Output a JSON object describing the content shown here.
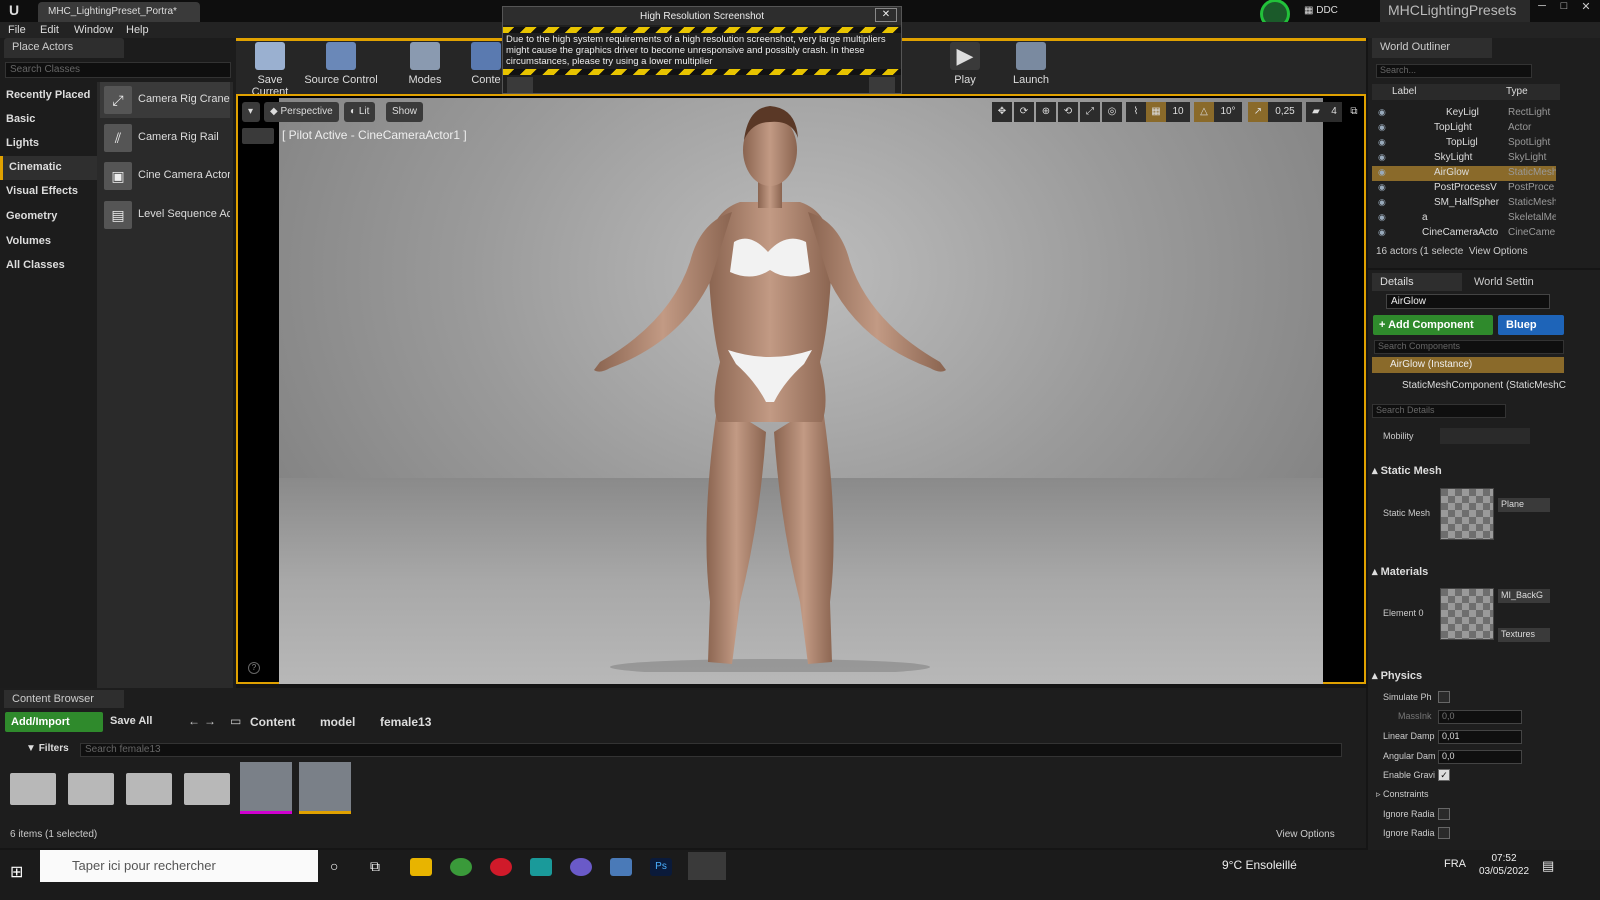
{
  "window": {
    "tab_title": "MHC_LightingPreset_Portra*",
    "ddc_label": "DDC",
    "project_name": "MHCLightingPresets",
    "minimize": "─",
    "maximize": "□",
    "close": "✕"
  },
  "menu": [
    "File",
    "Edit",
    "Window",
    "Help"
  ],
  "place_actors": {
    "tab": "Place Actors",
    "search_placeholder": "Search Classes",
    "categories": [
      "Recently Placed",
      "Basic",
      "Lights",
      "Cinematic",
      "Visual Effects",
      "Geometry",
      "Volumes",
      "All Classes"
    ],
    "selected_category": "Cinematic",
    "items": [
      "Camera Rig Crane",
      "Camera Rig Rail",
      "Cine Camera Actor",
      "Level Sequence Ac"
    ]
  },
  "toolbar": {
    "save_current": "Save Current",
    "source_control": "Source Control",
    "modes": "Modes",
    "content": "Conte",
    "play": "Play",
    "launch": "Launch"
  },
  "dialog": {
    "title": "High Resolution Screenshot",
    "text": "Due to the high system requirements of a high resolution screenshot, very large multipliers might cause the graphics driver to become unresponsive and possibly crash. In these circumstances, please try using a lower multiplier",
    "close": "✕"
  },
  "viewport": {
    "perspective": "Perspective",
    "lit": "Lit",
    "show": "Show",
    "pilot_label": "[ Pilot Active - CineCameraActor1 ]",
    "grid_snap": "10",
    "rot_snap": "10°",
    "scale_snap": "0,25",
    "cam_speed": "4"
  },
  "outliner": {
    "tab": "World Outliner",
    "search_placeholder": "Search...",
    "col_label": "Label",
    "col_type": "Type",
    "rows": [
      {
        "name": "KeyLigl",
        "type": "RectLight",
        "indent": 2
      },
      {
        "name": "TopLight",
        "type": "Actor",
        "indent": 1
      },
      {
        "name": "TopLigl",
        "type": "SpotLight",
        "indent": 2
      },
      {
        "name": "SkyLight",
        "type": "SkyLight",
        "indent": 1
      },
      {
        "name": "AirGlow",
        "type": "StaticMesh",
        "indent": 1,
        "selected": true
      },
      {
        "name": "PostProcessV",
        "type": "PostProce",
        "indent": 1
      },
      {
        "name": "SM_HalfSpher",
        "type": "StaticMesh",
        "indent": 1
      },
      {
        "name": "a",
        "type": "SkeletalMe",
        "indent": 0
      },
      {
        "name": "CineCameraActo",
        "type": "CineCame",
        "indent": 0
      }
    ],
    "status": "16 actors (1 selecte",
    "view_options": "View Options"
  },
  "details": {
    "tab": "Details",
    "world_settings_tab": "World Settin",
    "actor_name": "AirGlow",
    "add_component": "+ Add Component",
    "blueprint": "Bluep",
    "search_components": "Search Components",
    "instance": "AirGlow (Instance)",
    "component": "StaticMeshComponent (StaticMeshC",
    "search_details": "Search Details",
    "mobility": "Mobility",
    "static_mesh_section": "Static Mesh",
    "static_mesh_label": "Static Mesh",
    "static_mesh_value": "Plane",
    "materials_section": "Materials",
    "element0_label": "Element 0",
    "material_value": "MI_BackG",
    "textures": "Textures",
    "physics_section": "Physics",
    "simulate": "Simulate Ph",
    "mass": "MassInk",
    "mass_value": "0,0",
    "linear_damp": "Linear Damp",
    "linear_damp_value": "0,01",
    "angular_damp": "Angular Dam",
    "angular_damp_value": "0,0",
    "enable_gravity": "Enable Gravi",
    "constraints": "Constraints",
    "ignore_radial1": "Ignore Radia",
    "ignore_radial2": "Ignore Radia"
  },
  "content_browser": {
    "tab": "Content Browser",
    "add_import": "Add/Import",
    "save_all": "Save All",
    "breadcrumb": [
      "Content",
      "model",
      "female13"
    ],
    "filters": "Filters",
    "search_placeholder": "Search female13",
    "status": "6 items (1 selected)",
    "view_options": "View Options"
  },
  "taskbar": {
    "search_placeholder": "Taper ici pour rechercher",
    "weather": "9°C  Ensoleillé",
    "lang": "FRA",
    "time": "07:52",
    "date": "03/05/2022"
  },
  "colors": {
    "accent": "#e0a100",
    "green": "#2f8a2c",
    "blue": "#1e64b8"
  }
}
